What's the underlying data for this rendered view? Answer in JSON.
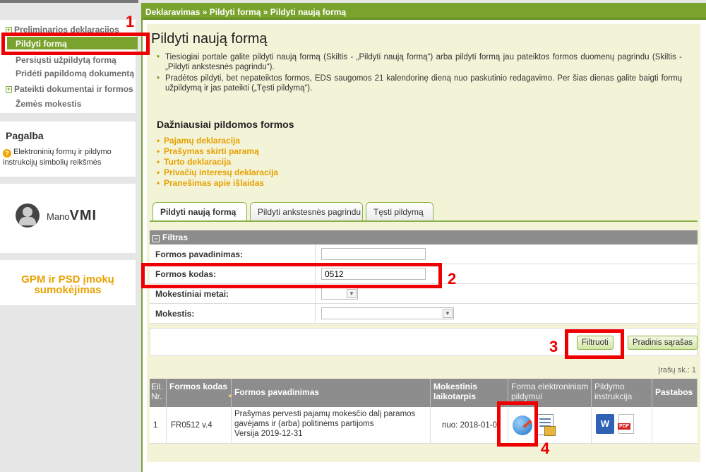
{
  "sidebar": {
    "nav_items": [
      {
        "label": "Preliminarios deklaracijos",
        "expandable": true
      },
      {
        "label": "Pildyti formą",
        "active": true
      },
      {
        "label": "Persiųsti užpildytą formą"
      },
      {
        "label": "Pridėti papildomą dokumentą"
      },
      {
        "label": "Pateikti dokumentai ir formos",
        "expandable": true
      },
      {
        "label": "Žemės mokestis"
      }
    ],
    "expand_symbol": "+",
    "help": {
      "title": "Pagalba",
      "link": "Elektroninių formų ir pildymo instrukcijų simbolių reikšmės"
    },
    "manovmi": {
      "prefix": "Mano",
      "suffix": "VMI"
    },
    "gpm": {
      "line1": "GPM ir PSD įmokų",
      "line2": "sumokėjimas"
    }
  },
  "breadcrumb": "Deklaravimas » Pildyti formą » Pildyti naują formą",
  "page_title": "Pildyti naują formą",
  "info": [
    "Tiesiogiai portale galite pildyti naują formą (Skiltis - „Pildyti naują formą“) arba pildyti formą jau pateiktos formos duomenų pagrindu (Skiltis - „Pildyti ankstesnės pagrindu“).",
    "Pradėtos pildyti, bet nepateiktos formos, EDS saugomos 21 kalendorinę dieną nuo paskutinio redagavimo. Per šias dienas galite baigti formų užpildymą ir jas pateikti („Tęsti pildymą“)."
  ],
  "frequent": {
    "title": "Dažniausiai pildomos formos",
    "items": [
      "Pajamų deklaracija",
      "Prašymas skirti paramą",
      "Turto deklaracija",
      "Privačių interesų deklaracija",
      "Pranešimas apie išlaidas"
    ]
  },
  "tabs": [
    "Pildyti naują formą",
    "Pildyti ankstesnės pagrindu",
    "Tęsti pildymą"
  ],
  "filter": {
    "title": "Filtras",
    "collapse_symbol": "−",
    "fields": {
      "name_label": "Formos pavadinimas:",
      "name_value": "",
      "code_label": "Formos kodas:",
      "code_value": "0512",
      "year_label": "Mokestiniai metai:",
      "year_value": "",
      "tax_label": "Mokestis:",
      "tax_value": ""
    },
    "filter_button": "Filtruoti",
    "reset_button": "Pradinis sąrašas"
  },
  "results": {
    "record_count": "Įrašų sk.: 1",
    "headers": {
      "no": "Eil. Nr.",
      "code": "Formos kodas",
      "name": "Formos pavadinimas",
      "period": "Mokestinis laikotarpis",
      "electronic": "Forma elektroniniam pildymui",
      "instruction": "Pildymo instrukcija",
      "notes": "Pastabos"
    },
    "sort_indicator": "▲",
    "rows": [
      {
        "no": "1",
        "code": "FR0512 v.4",
        "name_line1": "Prašymas pervesti pajamų mokesčio dalį paramos",
        "name_line2": "gavėjams ir (arba) politinėms partijoms",
        "version": "Versija 2019-12-31",
        "period": "nuo: 2018-01-0",
        "notes": ""
      }
    ],
    "icons": {
      "word": "W",
      "pdf": "PDF"
    }
  },
  "annotations": [
    "1",
    "2",
    "3",
    "4"
  ],
  "accent_color": "#7aa32d",
  "annotation_color": "#ee0000"
}
